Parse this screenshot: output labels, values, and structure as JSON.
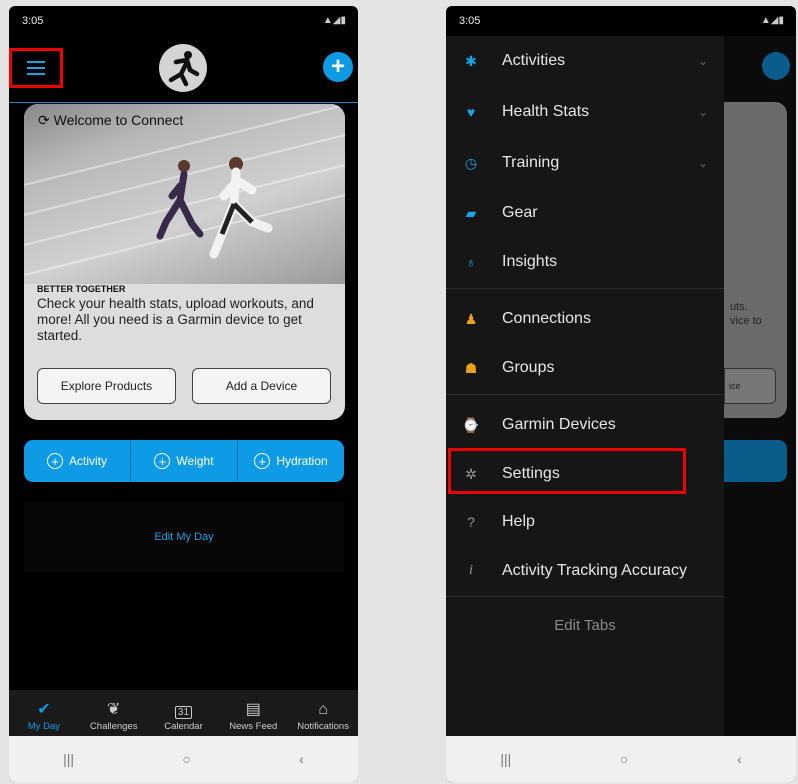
{
  "left_screen": {
    "status_time": "3:05",
    "welcome": "Welcome to Connect",
    "eyebrow": "BETTER TOGETHER",
    "body": "Check your health stats, upload workouts, and more! All you need is a Garmin device to get started.",
    "explore_label": "Explore Products",
    "add_device_label": "Add a Device",
    "quick_actions": [
      "Activity",
      "Weight",
      "Hydration"
    ],
    "edit_my_day": "Edit My Day",
    "bottom_nav": [
      "My Day",
      "Challenges",
      "Calendar",
      "News Feed",
      "Notifications"
    ],
    "calendar_day": "31"
  },
  "right_screen": {
    "status_time": "3:05",
    "menu": [
      {
        "label": "Activities",
        "icon": "activities-icon",
        "color": "#1aa3e8",
        "chevron": true
      },
      {
        "label": "Health Stats",
        "icon": "heart-icon",
        "color": "#1aa3e8",
        "chevron": true
      },
      {
        "label": "Training",
        "icon": "stopwatch-icon",
        "color": "#1aa3e8",
        "chevron": true
      },
      {
        "label": "Gear",
        "icon": "shoe-icon",
        "color": "#1aa3e8",
        "chevron": false
      },
      {
        "label": "Insights",
        "icon": "lightbulb-icon",
        "color": "#1aa3e8",
        "chevron": false
      },
      {
        "label": "Connections",
        "icon": "people-icon",
        "color": "#e8a31a",
        "chevron": false
      },
      {
        "label": "Groups",
        "icon": "group-icon",
        "color": "#e8a31a",
        "chevron": false
      },
      {
        "label": "Garmin Devices",
        "icon": "watch-icon",
        "color": "#999999",
        "chevron": false
      },
      {
        "label": "Settings",
        "icon": "gear-icon",
        "color": "#999999",
        "chevron": false
      },
      {
        "label": "Help",
        "icon": "question-icon",
        "color": "#999999",
        "chevron": false
      },
      {
        "label": "Activity Tracking Accuracy",
        "icon": "info-icon",
        "color": "#999999",
        "chevron": false
      }
    ],
    "edit_tabs": "Edit Tabs",
    "underlay_text": "uts.\nvice to",
    "underlay_btn": "ice"
  },
  "colors": {
    "accent": "#0d9be6",
    "highlight": "#e00000"
  }
}
